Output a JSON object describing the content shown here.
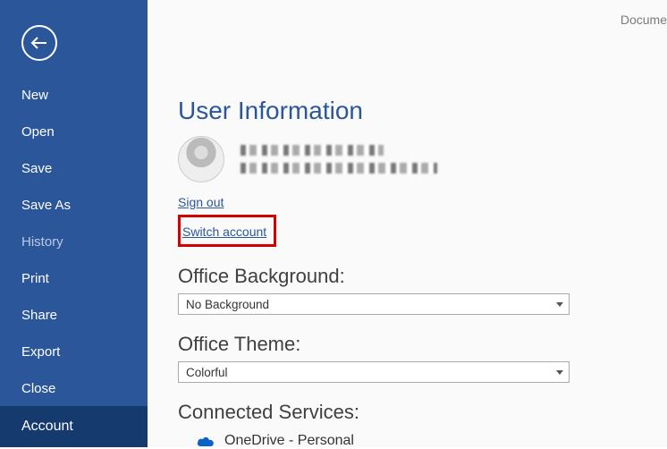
{
  "topRight": "Docume",
  "sidebar": {
    "items": [
      {
        "label": "New"
      },
      {
        "label": "Open"
      },
      {
        "label": "Save"
      },
      {
        "label": "Save As"
      },
      {
        "label": "History"
      },
      {
        "label": "Print"
      },
      {
        "label": "Share"
      },
      {
        "label": "Export"
      },
      {
        "label": "Close"
      }
    ],
    "selected": "Account"
  },
  "main": {
    "title": "User Information",
    "signOut": "Sign out",
    "switchAccount": "Switch account",
    "bgHeading": "Office Background:",
    "bgValue": "No Background",
    "themeHeading": "Office Theme:",
    "themeValue": "Colorful",
    "servicesHeading": "Connected Services:",
    "service1": "OneDrive - Personal"
  }
}
